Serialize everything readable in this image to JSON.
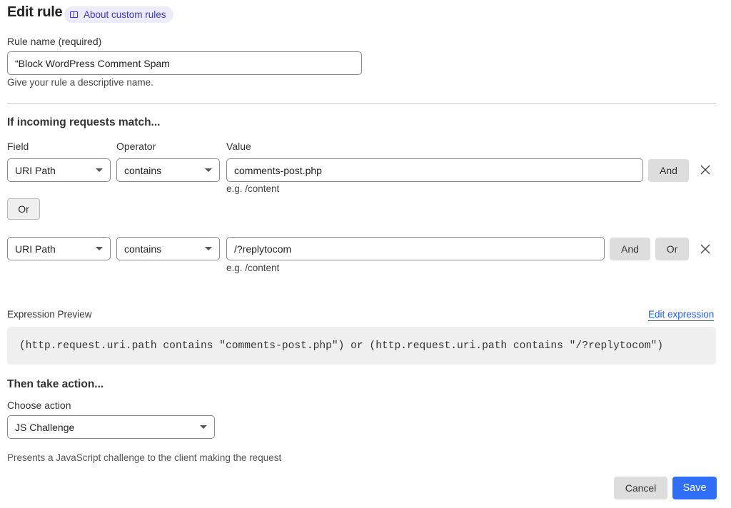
{
  "header": {
    "title": "Edit rule",
    "help_link": {
      "label": "About custom rules",
      "icon": "book-icon"
    }
  },
  "rule_name": {
    "label": "Rule name (required)",
    "value": "“Block WordPress Comment Spam",
    "hint": "Give your rule a descriptive name."
  },
  "match": {
    "heading": "If incoming requests match...",
    "columns": {
      "field": "Field",
      "operator": "Operator",
      "value": "Value"
    },
    "conditions": [
      {
        "field": "URI Path",
        "operator": "contains",
        "value": "comments-post.php",
        "hint": "e.g. /content",
        "buttons": [
          "And"
        ]
      },
      {
        "field": "URI Path",
        "operator": "contains",
        "value": "/?replytocom",
        "hint": "e.g. /content",
        "buttons": [
          "And",
          "Or"
        ]
      }
    ],
    "or_button": "Or"
  },
  "expression": {
    "label": "Expression Preview",
    "edit_link": "Edit expression",
    "code": "(http.request.uri.path contains \"comments-post.php\") or (http.request.uri.path contains \"/?replytocom\")"
  },
  "action": {
    "heading": "Then take action...",
    "label": "Choose action",
    "selected": "JS Challenge",
    "description": "Presents a JavaScript challenge to the client making the request"
  },
  "footer": {
    "cancel": "Cancel",
    "save": "Save"
  },
  "colors": {
    "primary": "#2f6ef5",
    "link": "#2a61d6",
    "pill_bg": "#ecebfb",
    "pill_text": "#3f3ab2"
  }
}
